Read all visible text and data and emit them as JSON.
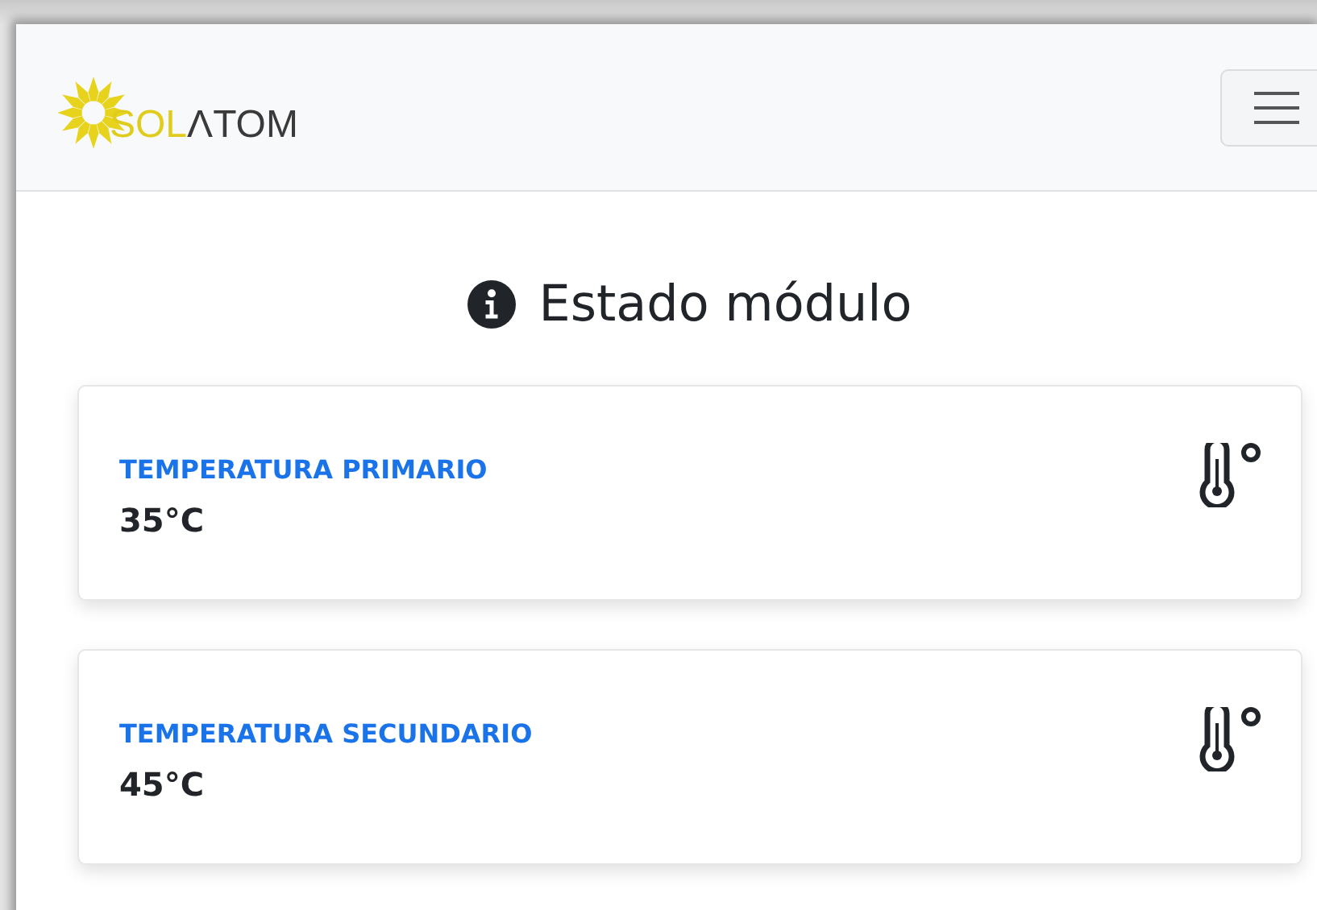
{
  "navbar": {
    "brand": {
      "part_1": "SOL",
      "part_2": "ΛTOM"
    }
  },
  "heading": "Estado módulo",
  "cards": [
    {
      "label": "TEMPERATURA PRIMARIO",
      "value": "35°C"
    },
    {
      "label": "TEMPERATURA SECUNDARIO",
      "value": "45°C"
    }
  ]
}
